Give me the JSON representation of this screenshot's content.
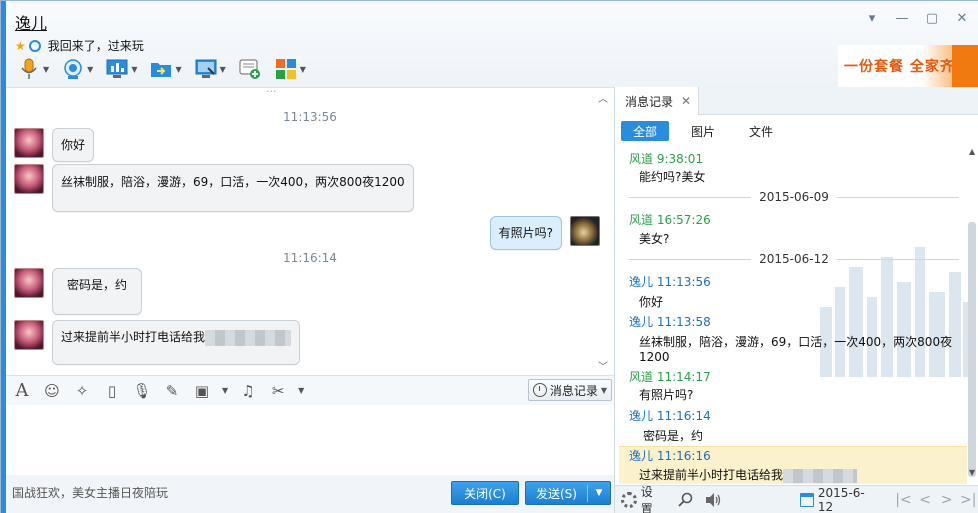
{
  "header": {
    "contact_name": "逸儿",
    "status_text": "我回来了，过来玩",
    "ad_text": "一份套餐 全家齐享"
  },
  "window_controls": [
    {
      "name": "dropdown-control-icon",
      "glyph": "▾"
    },
    {
      "name": "minimize-icon",
      "glyph": "—"
    },
    {
      "name": "maximize-icon",
      "glyph": "▢"
    },
    {
      "name": "close-window-icon",
      "glyph": "✕"
    }
  ],
  "chat": {
    "top_fragment": "...",
    "messages": [
      {
        "type": "time",
        "text": "11:13:56"
      },
      {
        "type": "msg",
        "side": "left",
        "text": "你好"
      },
      {
        "type": "msg",
        "side": "left",
        "text": "丝袜制服，陪浴，漫游，69，口活，一次400，两次800夜1200"
      },
      {
        "type": "msg",
        "side": "right",
        "text": "有照片吗?"
      },
      {
        "type": "time",
        "text": "11:16:14"
      },
      {
        "type": "msg",
        "side": "left",
        "text": "密码是，约"
      },
      {
        "type": "msg",
        "side": "left",
        "text": "过来提前半小时打电话给我"
      }
    ]
  },
  "input_toolbar": {
    "history_label": "消息记录"
  },
  "bottom": {
    "ad_line": "国战狂欢，美女主播日夜陪玩",
    "close_label": "关闭(C)",
    "send_label": "发送(S)"
  },
  "history_panel": {
    "tab_label": "消息记录",
    "filters": [
      "全部",
      "图片",
      "文件"
    ],
    "entries": [
      {
        "kind": "head",
        "color": "green",
        "text": "风道 9:38:01"
      },
      {
        "kind": "body",
        "text": "能约吗?美女"
      },
      {
        "kind": "date",
        "text": "2015-06-09"
      },
      {
        "kind": "head",
        "color": "green",
        "text": "风道 16:57:26"
      },
      {
        "kind": "body",
        "text": "美女?"
      },
      {
        "kind": "date",
        "text": "2015-06-12"
      },
      {
        "kind": "head",
        "color": "blue",
        "text": "逸儿 11:13:56"
      },
      {
        "kind": "body",
        "text": "你好"
      },
      {
        "kind": "head",
        "color": "blue",
        "text": "逸儿 11:13:58"
      },
      {
        "kind": "body",
        "text": "丝袜制服，陪浴，漫游，69，口活，一次400，两次800夜1200"
      },
      {
        "kind": "head",
        "color": "green",
        "text": "风道 11:14:17"
      },
      {
        "kind": "body",
        "text": "有照片吗?"
      },
      {
        "kind": "head",
        "color": "blue",
        "text": "逸儿 11:16:14"
      },
      {
        "kind": "body",
        "text": "密码是，约"
      },
      {
        "kind": "head",
        "color": "blue",
        "text": "逸儿 11:16:16"
      },
      {
        "kind": "body",
        "text": "过来提前半小时打电话给我"
      }
    ],
    "settings_label": "设置",
    "date_value": "2015-6-12"
  },
  "colors": {
    "accent": "#2a8ddc",
    "green_name": "#2aa04a",
    "blue_name": "#1b6fbf"
  }
}
